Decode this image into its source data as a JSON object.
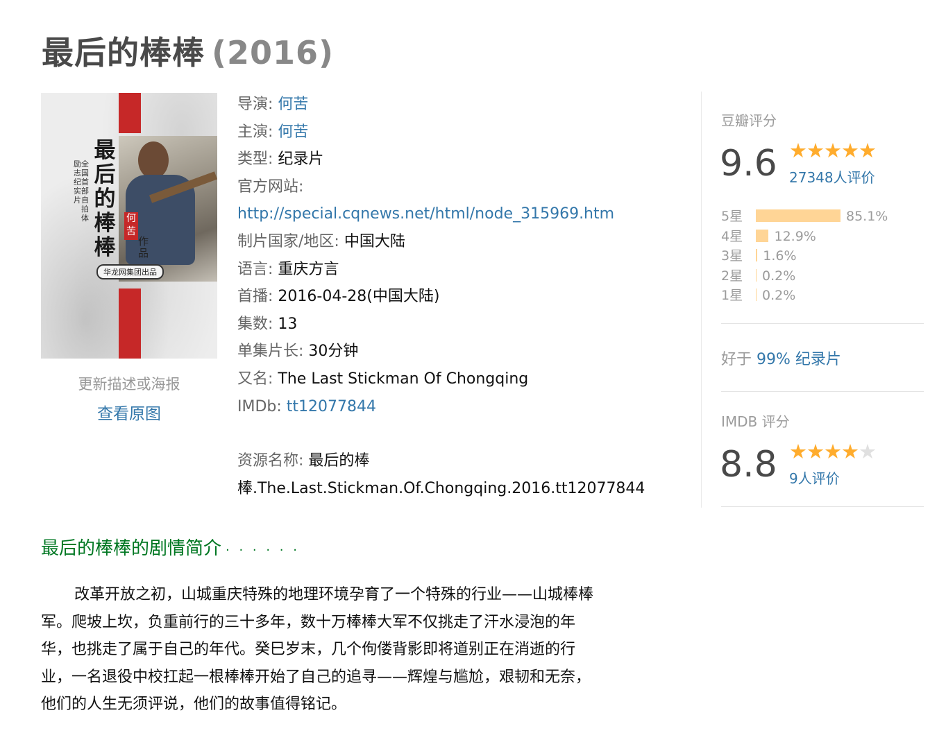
{
  "movie": {
    "title": "最后的棒棒",
    "year": "(2016)"
  },
  "poster": {
    "title_text": "最后的棒棒",
    "subtitle_1": "全国首部自拍体",
    "subtitle_2": "励志纪实片",
    "seal": "何苦",
    "work_label": "作品",
    "publisher": "华龙网集团出品",
    "caption": "更新描述或海报",
    "view_original": "查看原图"
  },
  "info": {
    "director_label": "导演:",
    "director": "何苦",
    "cast_label": "主演:",
    "cast": "何苦",
    "genre_label": "类型:",
    "genre": "纪录片",
    "website_label": "官方网站:",
    "website": "http://special.cqnews.net/html/node_315969.htm",
    "country_label": "制片国家/地区:",
    "country": "中国大陆",
    "language_label": "语言:",
    "language": "重庆方言",
    "premiere_label": "首播:",
    "premiere": "2016-04-28(中国大陆)",
    "episodes_label": "集数:",
    "episodes": "13",
    "runtime_label": "单集片长:",
    "runtime": "30分钟",
    "aka_label": "又名:",
    "aka": "The Last Stickman Of Chongqing",
    "imdb_label": "IMDb:",
    "imdb": "tt12077844",
    "resource_label": "资源名称:",
    "resource_line1": "最后的棒",
    "resource_line2": "棒.The.Last.Stickman.Of.Chongqing.2016.tt12077844"
  },
  "douban_rating": {
    "title": "豆瓣评分",
    "score": "9.6",
    "stars": 5,
    "votes": "27348人评价",
    "breakdown": [
      {
        "label": "5星",
        "percent": 85.1,
        "text": "85.1%"
      },
      {
        "label": "4星",
        "percent": 12.9,
        "text": "12.9%"
      },
      {
        "label": "3星",
        "percent": 1.6,
        "text": "1.6%"
      },
      {
        "label": "2星",
        "percent": 0.2,
        "text": "0.2%"
      },
      {
        "label": "1星",
        "percent": 0.2,
        "text": "0.2%"
      }
    ],
    "better_prefix": "好于",
    "better_value": "99% 纪录片"
  },
  "imdb_rating": {
    "title": "IMDB 评分",
    "score": "8.8",
    "stars": 4,
    "votes": "9人评价"
  },
  "synopsis": {
    "heading": "最后的棒棒的剧情简介",
    "dots": "· · · · · ·",
    "lines": [
      "改革开放之初，山城重庆特殊的地理环境孕育了一个特殊的行业——山城棒棒",
      "军。爬坡上坎，负重前行的三十多年，数十万棒棒大军不仅挑走了汗水浸泡的年",
      "华，也挑走了属于自己的年代。癸巳岁末，几个佝偻背影即将道别正在消逝的行",
      "业，一名退役中校扛起一根棒棒开始了自己的追寻——辉煌与尴尬，艰韧和无奈，",
      "他们的人生无须评说，他们的故事值得铭记。"
    ]
  },
  "colors": {
    "link": "#3377aa",
    "heading_green": "#007722",
    "star": "#ffac2d",
    "bar": "#ffd596"
  }
}
